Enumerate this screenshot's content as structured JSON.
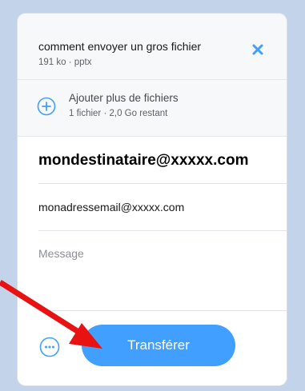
{
  "file": {
    "name": "comment envoyer un gros fichier",
    "meta": "191 ko · pptx",
    "close_icon": "close-icon"
  },
  "add_files": {
    "title": "Ajouter plus de fichiers",
    "subtitle": "1 fichier · 2,0 Go restant",
    "icon": "plus-circle-icon"
  },
  "form": {
    "recipient_value": "mondestinataire@xxxxx.com",
    "sender_value": "monadressemail@xxxxx.com",
    "message_placeholder": "Message"
  },
  "actions": {
    "options_icon": "more-options-icon",
    "transfer_label": "Transférer"
  },
  "colors": {
    "accent": "#409fff",
    "close_icon": "#409fff",
    "annotation_arrow": "#e81212",
    "background": "#c3d4ea"
  }
}
